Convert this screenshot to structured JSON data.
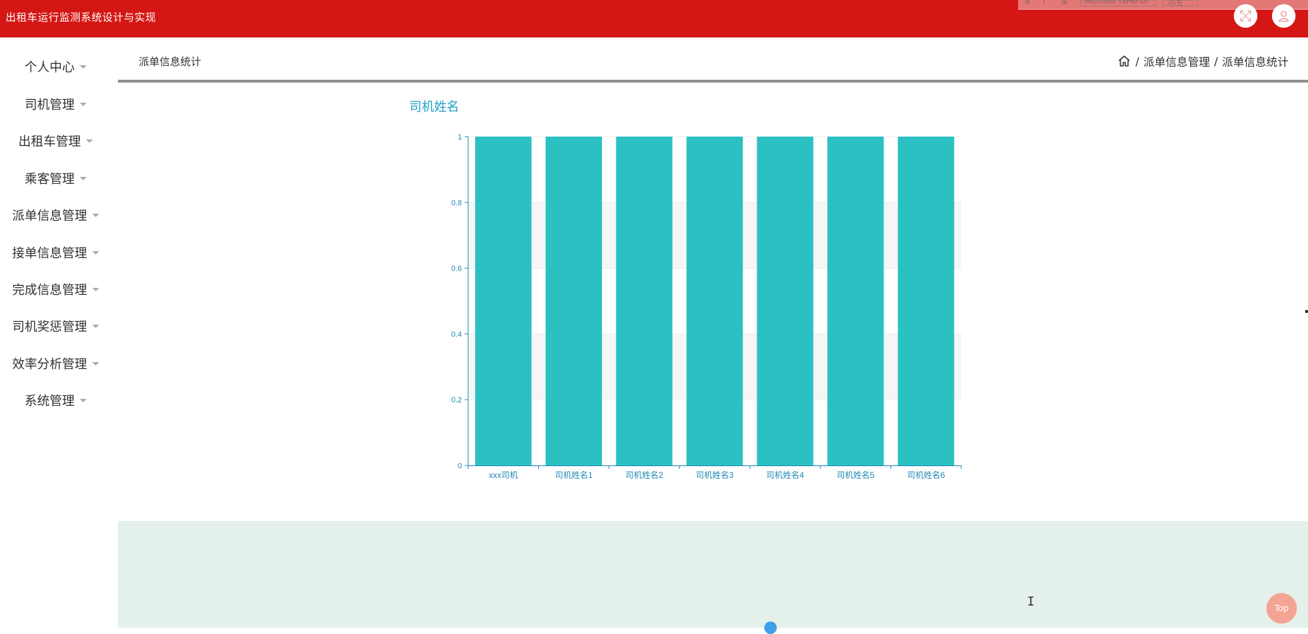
{
  "app": {
    "title": "出租车运行监测系统设计与实现"
  },
  "ghost_toolbar": {
    "font_label": "Microsoft YaHei UI",
    "size_label": "小五"
  },
  "header_buttons": {
    "fullscreen_icon": "fullscreen-icon",
    "user_icon": "user-icon"
  },
  "sidebar": {
    "items": [
      {
        "label": "个人中心"
      },
      {
        "label": "司机管理"
      },
      {
        "label": "出租车管理"
      },
      {
        "label": "乘客管理"
      },
      {
        "label": "派单信息管理"
      },
      {
        "label": "接单信息管理"
      },
      {
        "label": "完成信息管理"
      },
      {
        "label": "司机奖惩管理"
      },
      {
        "label": "效率分析管理"
      },
      {
        "label": "系统管理"
      }
    ]
  },
  "page": {
    "title": "派单信息统计",
    "breadcrumb": {
      "sep1": "/",
      "level1": "派单信息管理",
      "sep2": "/",
      "level2": "派单信息统计"
    }
  },
  "chart_data": {
    "type": "bar",
    "title": "司机姓名",
    "xlabel": "",
    "ylabel": "",
    "categories": [
      "xxx司机",
      "司机姓名1",
      "司机姓名2",
      "司机姓名3",
      "司机姓名4",
      "司机姓名5",
      "司机姓名6"
    ],
    "values": [
      1,
      1,
      1,
      1,
      1,
      1,
      1
    ],
    "ylim": [
      0,
      1
    ],
    "yticks": [
      "0",
      "0.2",
      "0.4",
      "0.6",
      "0.8",
      "1"
    ],
    "bar_color": "#2bc1c3",
    "axis_color": "#1e88b6",
    "grid": true
  },
  "colors": {
    "header": "#d41714",
    "footer": "#e4f1ea",
    "title_accent": "#1ea1c8",
    "top_button": "#f4a494"
  },
  "top_button": {
    "label": "Top"
  }
}
